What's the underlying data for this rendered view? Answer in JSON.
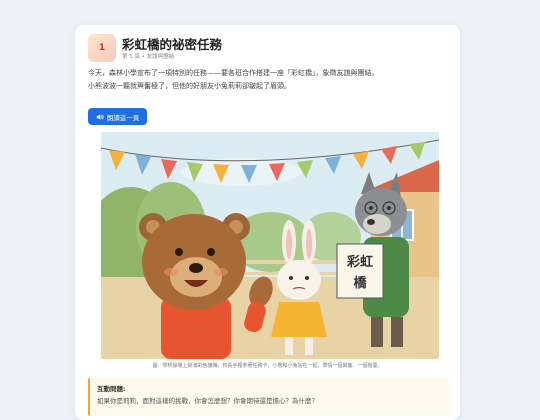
{
  "story": {
    "number": "1",
    "title": "彩虹橋的祕密任務",
    "meta": "第 1 頁 • 友誼與團結",
    "paragraph_1": "今天，森林小學宣布了一項特別的任務——要各班合作搭建一座「彩虹橋」，象徵友誼與團結。",
    "paragraph_2": "小熊波波一聽就興奮極了，但他的好朋友小兔莉莉卻皺起了眉頭。",
    "read_button": "朗讀這一頁",
    "read_icon": "speaker-icon",
    "caption": "圖：學校操場上掛滿彩色旗幟，校長手裡拿著任務卡，小熊和小兔站在一起，表情一個興奮、一個擔憂。",
    "sign_text_1": "彩虹",
    "sign_text_2": "橋"
  },
  "interactive_question": {
    "title": "互動問題:",
    "text": "如果你是莉莉，面對這樣的挑戰，你會怎麼想？你會期待還是擔心？為什麼？"
  },
  "colors": {
    "accent": "#1f6fe0",
    "question_border": "#f0a63c",
    "background": "#eef2f8"
  }
}
